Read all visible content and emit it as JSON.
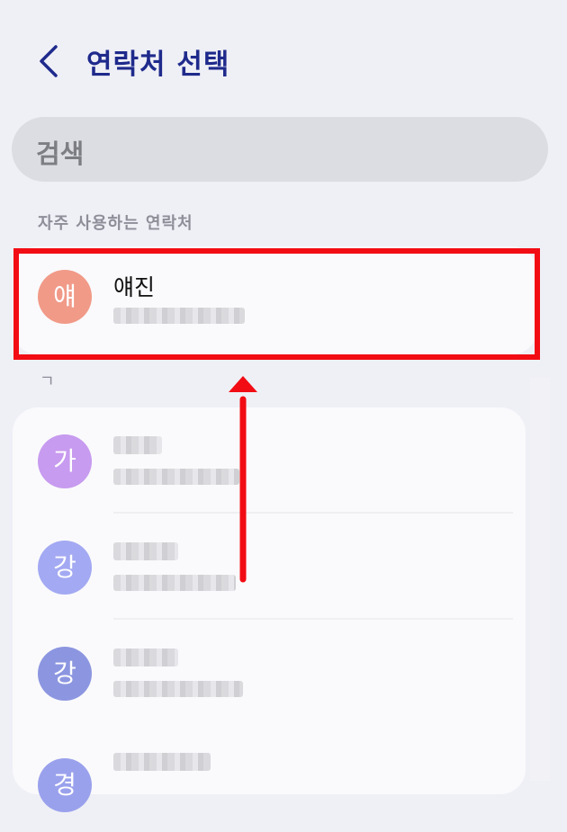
{
  "header": {
    "title": "연락처 선택"
  },
  "search": {
    "placeholder": "검색"
  },
  "favorites": {
    "section_label": "자주 사용하는 연락처",
    "items": [
      {
        "avatar_letter": "얘",
        "name": "얘진",
        "avatar_color": "#f19a88"
      }
    ]
  },
  "contacts": {
    "index_letter": "ㄱ",
    "items": [
      {
        "avatar_letter": "가",
        "avatar_color": "#c79bef"
      },
      {
        "avatar_letter": "강",
        "avatar_color": "#a3a9f2"
      },
      {
        "avatar_letter": "강",
        "avatar_color": "#8c96e0"
      },
      {
        "avatar_letter": "경",
        "avatar_color": "#9aa1ec"
      }
    ]
  },
  "colors": {
    "accent": "#1f2a8c",
    "highlight": "#f20c14",
    "background": "#eff0f6"
  }
}
